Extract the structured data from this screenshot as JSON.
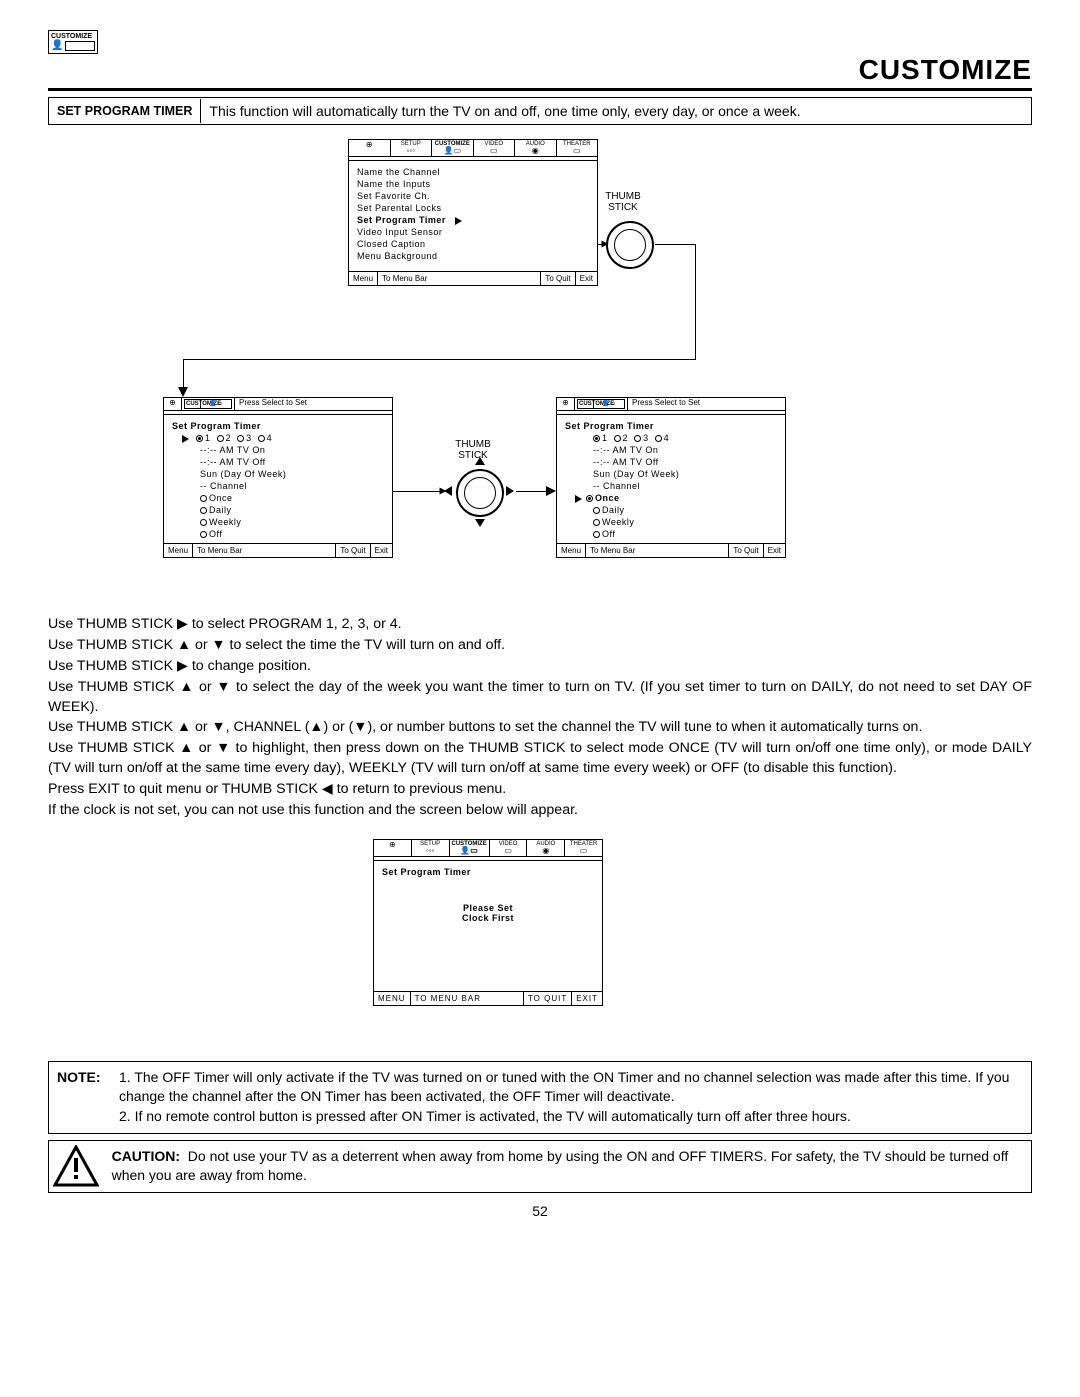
{
  "header": {
    "icon_label": "CUSTOMIZE",
    "page_title": "CUSTOMIZE"
  },
  "section": {
    "heading": "SET PROGRAM TIMER",
    "description": "This function will automatically turn the TV on and off, one time only, every day, or once a week."
  },
  "menubar_tabs": [
    "SETUP",
    "CUSTOMIZE",
    "VIDEO",
    "AUDIO",
    "THEATER"
  ],
  "osd1": {
    "items": [
      "Name the Channel",
      "Name the Inputs",
      "Set Favorite Ch.",
      "Set Parental Locks",
      "Set Program Timer",
      "Video Input Sensor",
      "Closed Caption",
      "Menu Background"
    ],
    "selected_index": 4,
    "status": {
      "menu": "Menu",
      "bar": "To Menu Bar",
      "quit": "To Quit",
      "exit": "Exit"
    }
  },
  "thumbstick_label": "THUMB\nSTICK",
  "osd2": {
    "mini_header": "Press Select to Set",
    "title": "Set Program Timer",
    "programs": [
      {
        "n": "1",
        "sel": true
      },
      {
        "n": "2",
        "sel": false
      },
      {
        "n": "3",
        "sel": false
      },
      {
        "n": "4",
        "sel": false
      }
    ],
    "lines": [
      "--:-- AM TV On",
      "--:-- AM TV Off",
      "Sun (Day Of Week)",
      "-- Channel"
    ],
    "modes": [
      {
        "label": "Once",
        "sel": false
      },
      {
        "label": "Daily",
        "sel": false
      },
      {
        "label": "Weekly",
        "sel": false
      },
      {
        "label": "Off",
        "sel": false
      }
    ],
    "pointer_on_programs": true,
    "status": {
      "menu": "Menu",
      "bar": "To Menu Bar",
      "quit": "To Quit",
      "exit": "Exit"
    }
  },
  "osd3": {
    "mini_header": "Press Select to Set",
    "title": "Set Program Timer",
    "programs": [
      {
        "n": "1",
        "sel": true
      },
      {
        "n": "2",
        "sel": false
      },
      {
        "n": "3",
        "sel": false
      },
      {
        "n": "4",
        "sel": false
      }
    ],
    "lines": [
      "--:-- AM TV On",
      "--:-- AM TV Off",
      "Sun (Day Of Week)",
      "-- Channel"
    ],
    "modes": [
      {
        "label": "Once",
        "sel": true
      },
      {
        "label": "Daily",
        "sel": false
      },
      {
        "label": "Weekly",
        "sel": false
      },
      {
        "label": "Off",
        "sel": false
      }
    ],
    "pointer_on_once": true,
    "status": {
      "menu": "Menu",
      "bar": "To Menu Bar",
      "quit": "To Quit",
      "exit": "Exit"
    }
  },
  "instructions": {
    "l1": "Use THUMB STICK ▶ to select PROGRAM 1, 2, 3, or 4.",
    "l2": "Use THUMB STICK ▲ or ▼ to select the time the TV will turn on and off.",
    "l3": "Use THUMB STICK ▶ to change position.",
    "l4": "Use THUMB STICK ▲ or ▼ to select the day of the week you want the timer to turn on TV. (If you set timer to turn on DAILY, do not need to set DAY OF WEEK).",
    "l5": "Use THUMB STICK ▲ or ▼, CHANNEL (▲) or (▼), or number buttons to set the channel the TV will tune to when it automatically turns on.",
    "l6": "Use THUMB STICK ▲ or ▼ to highlight, then press down on the THUMB STICK to select mode ONCE (TV will turn on/off one time only), or mode DAILY (TV will turn on/off at the same time every day), WEEKLY (TV will turn on/off at same time every week) or OFF (to disable this function).",
    "l7": "Press EXIT to quit menu or THUMB STICK ◀ to return to previous menu.",
    "l8": "If the clock is not set, you can not use this function and the screen below will appear."
  },
  "osd4": {
    "title": "Set Program Timer",
    "msg1": "Please Set",
    "msg2": "Clock First",
    "status": {
      "menu": "MENU",
      "bar": "TO MENU BAR",
      "quit": "TO QUIT",
      "exit": "EXIT"
    }
  },
  "note": {
    "label": "NOTE:",
    "n1": "1. The OFF Timer will only activate if the TV was turned on or tuned with the ON Timer and no channel selection was made after this time.  If you change the channel after the ON Timer has been activated, the OFF Timer will deactivate.",
    "n2": "2. If no remote control button is pressed after ON Timer is activated, the TV will automatically turn off after three hours."
  },
  "caution": {
    "label": "CAUTION:",
    "text": "Do not use your TV as a deterrent when away from home by using the ON and OFF TIMERS.  For safety, the TV should be turned off when you are away from home."
  },
  "page_number": "52"
}
